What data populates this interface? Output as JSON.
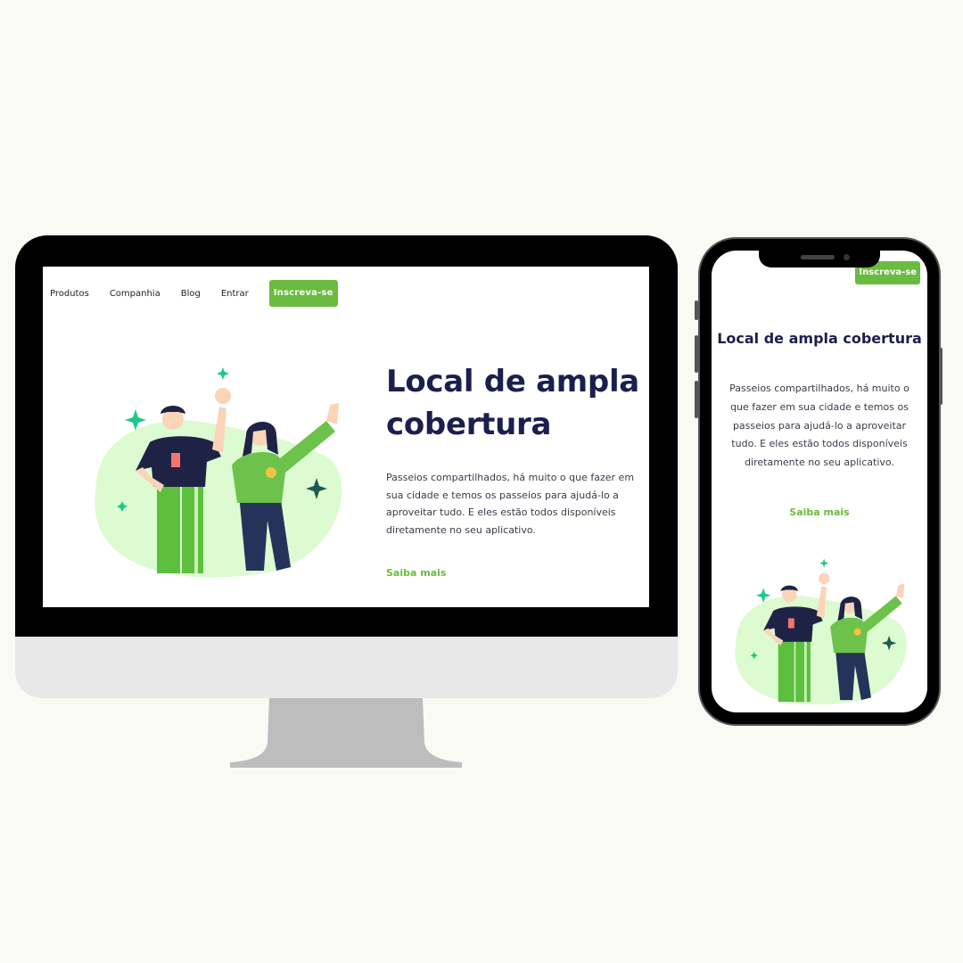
{
  "desktop": {
    "nav": {
      "links": [
        "Produtos",
        "Companhia",
        "Blog",
        "Entrar"
      ],
      "cta": "Inscreva-se"
    },
    "hero": {
      "title": "Local de ampla cobertura",
      "paragraph": "Passeios compartilhados, há muito o que fazer em sua cidade e temos os passeios para ajudá-lo a aproveitar tudo. E eles estão todos disponíveis diretamente no seu aplicativo.",
      "link": "Saiba mais"
    }
  },
  "mobile": {
    "cta": "Inscreva-se",
    "hero": {
      "title": "Local de ampla cobertura",
      "paragraph": "Passeios compartilhados, há muito o que fazer em sua cidade e temos os passeios para ajudá-lo a aproveitar tudo. E eles estão todos disponíveis diretamente no seu aplicativo.",
      "link": "Saiba mais"
    }
  },
  "colors": {
    "accent": "#6abb3f",
    "heading": "#1a1f4e",
    "background": "#f9faf4",
    "blob": "#dcfbd0"
  },
  "icons": [
    "sparkle-icon"
  ]
}
